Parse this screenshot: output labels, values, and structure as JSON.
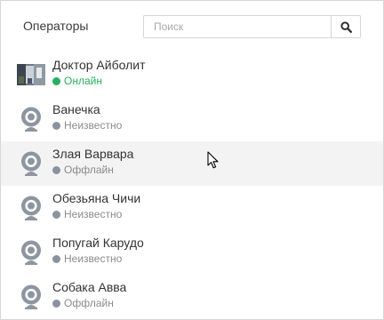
{
  "header": {
    "title": "Операторы",
    "search_placeholder": "Поиск",
    "search_icon": "search-icon"
  },
  "colors": {
    "online": "#27ae60",
    "offline": "#8a93a0",
    "hover_row": "#f3f3f3"
  },
  "operators": [
    {
      "name": "Доктор Айболит",
      "status": "Онлайн",
      "state": "online",
      "avatar": "photo"
    },
    {
      "name": "Ванечка",
      "status": "Неизвестно",
      "state": "unknown",
      "avatar": "webcam-icon"
    },
    {
      "name": "Злая Варвара",
      "status": "Оффлайн",
      "state": "offline",
      "avatar": "webcam-icon"
    },
    {
      "name": "Обезьяна Чичи",
      "status": "Неизвестно",
      "state": "unknown",
      "avatar": "webcam-icon"
    },
    {
      "name": "Попугай Карудо",
      "status": "Неизвестно",
      "state": "unknown",
      "avatar": "webcam-icon"
    },
    {
      "name": "Собака Авва",
      "status": "Оффлайн",
      "state": "offline",
      "avatar": "webcam-icon"
    }
  ]
}
